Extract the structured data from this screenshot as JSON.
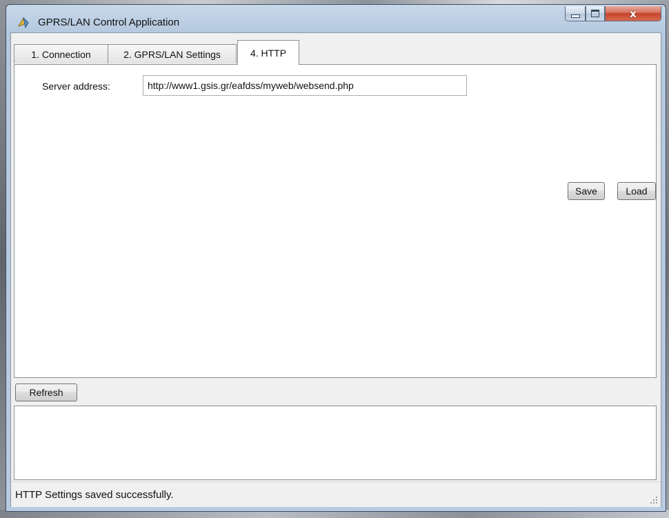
{
  "window": {
    "title": "GPRS/LAN Control Application",
    "controls": {
      "minimize": "minimize",
      "maximize": "maximize",
      "close": "x"
    }
  },
  "tabs": [
    {
      "label": "1. Connection",
      "active": false
    },
    {
      "label": "2. GPRS/LAN Settings",
      "active": false
    },
    {
      "label": "4. HTTP",
      "active": true
    }
  ],
  "http": {
    "server_label": "Server address:",
    "server_value": "http://www1.gsis.gr/eafdss/myweb/websend.php",
    "save_label": "Save",
    "load_label": "Load"
  },
  "toolbar": {
    "refresh_label": "Refresh"
  },
  "status": {
    "text": "HTTP Settings saved successfully."
  },
  "icons": {
    "app": "app-icon",
    "minimize": "minimize-icon",
    "maximize": "maximize-icon",
    "close": "close-icon",
    "grip": "resize-grip-icon"
  },
  "colors": {
    "titlebar": "#b9cbe0",
    "close_button": "#c4432b",
    "panel_background": "#ffffff",
    "chrome_background": "#f0f0f0"
  }
}
